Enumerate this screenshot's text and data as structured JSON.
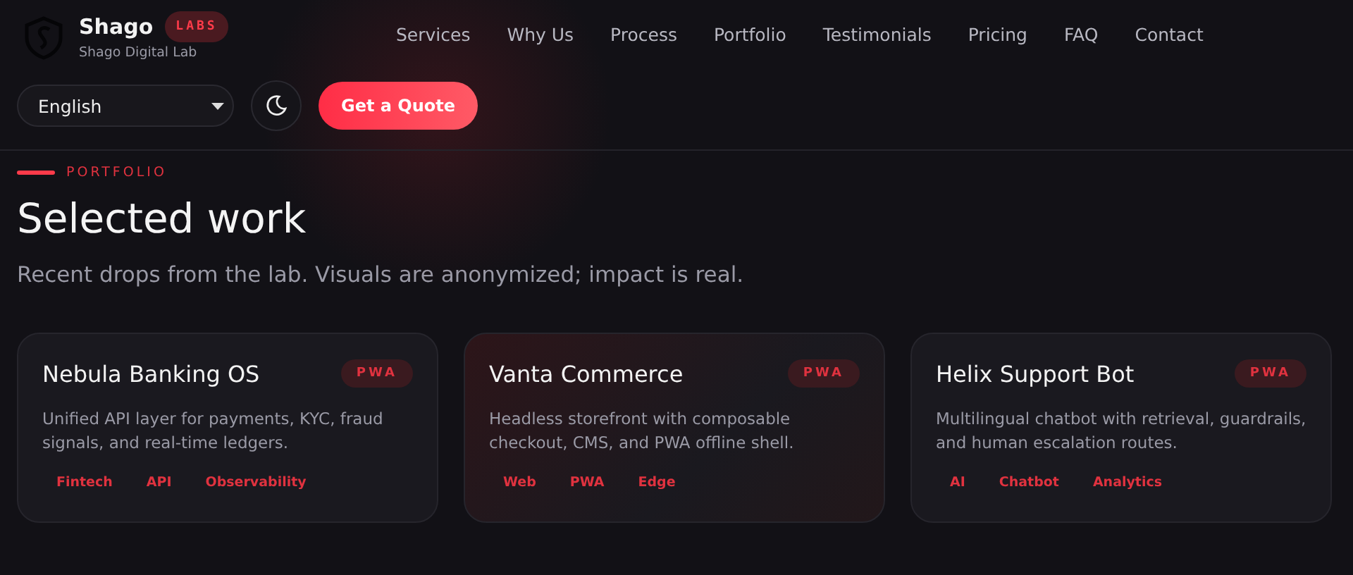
{
  "brand": {
    "name": "Shago",
    "badge": "LABS",
    "tagline": "Shago Digital Lab"
  },
  "nav": [
    "Services",
    "Why Us",
    "Process",
    "Portfolio",
    "Testimonials",
    "Pricing",
    "FAQ",
    "Contact"
  ],
  "language": {
    "value": "English"
  },
  "cta": "Get a Quote",
  "section": {
    "eyebrow": "PORTFOLIO",
    "title": "Selected work",
    "subtitle": "Recent drops from the lab. Visuals are anonymized; impact is real."
  },
  "projects": [
    {
      "title": "Nebula Banking OS",
      "badge": "PWA",
      "description": "Unified API layer for payments, KYC, fraud signals, and real-time ledgers.",
      "tags": [
        "Fintech",
        "API",
        "Observability"
      ],
      "highlighted": false
    },
    {
      "title": "Vanta Commerce",
      "badge": "PWA",
      "description": "Headless storefront with composable checkout, CMS, and PWA offline shell.",
      "tags": [
        "Web",
        "PWA",
        "Edge"
      ],
      "highlighted": true
    },
    {
      "title": "Helix Support Bot",
      "badge": "PWA",
      "description": "Multilingual chatbot with retrieval, guardrails, and human escalation routes.",
      "tags": [
        "AI",
        "Chatbot",
        "Analytics"
      ],
      "highlighted": false
    }
  ]
}
